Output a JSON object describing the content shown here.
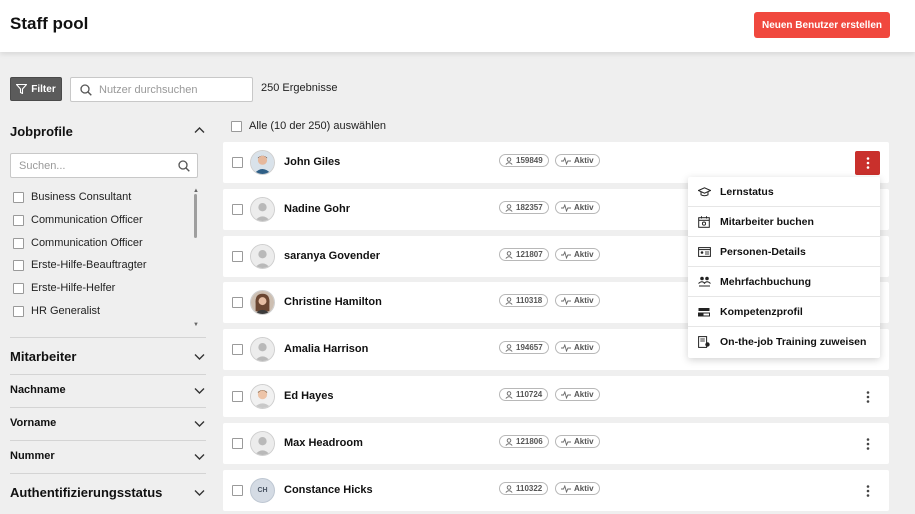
{
  "header": {
    "title": "Staff pool",
    "create_button": "Neuen Benutzer erstellen",
    "accent_color": "#f0483e"
  },
  "toolbar": {
    "filter_label": "Filter",
    "search_placeholder": "Nutzer durchsuchen",
    "result_count": "250 Ergebnisse"
  },
  "sidebar": {
    "jobprofile": {
      "title": "Jobprofile",
      "search_placeholder": "Suchen...",
      "items": [
        "Business Consultant",
        "Communication Officer",
        "Communication Officer",
        "Erste-Hilfe-Beauftragter",
        "Erste-Hilfe-Helfer",
        "HR Generalist"
      ]
    },
    "sections": [
      {
        "title": "Mitarbeiter"
      },
      {
        "title": "Nachname"
      },
      {
        "title": "Vorname"
      },
      {
        "title": "Nummer"
      },
      {
        "title": "Authentifizierungsstatus"
      }
    ]
  },
  "list": {
    "select_all": "Alle (10 der 250) auswählen",
    "rows": [
      {
        "name": "John Giles",
        "id": "159849",
        "status": "Aktiv",
        "avatar": "photo-icon"
      },
      {
        "name": "Nadine Gohr",
        "id": "182357",
        "status": "Aktiv",
        "avatar": "person-placeholder-icon"
      },
      {
        "name": "saranya Govender",
        "id": "121807",
        "status": "Aktiv",
        "avatar": "person-placeholder-icon"
      },
      {
        "name": "Christine Hamilton",
        "id": "110318",
        "status": "Aktiv",
        "avatar": "photo-icon"
      },
      {
        "name": "Amalia Harrison",
        "id": "194657",
        "status": "Aktiv",
        "avatar": "person-placeholder-icon"
      },
      {
        "name": "Ed Hayes",
        "id": "110724",
        "status": "Aktiv",
        "avatar": "photo-icon"
      },
      {
        "name": "Max Headroom",
        "id": "121806",
        "status": "Aktiv",
        "avatar": "person-placeholder-icon"
      },
      {
        "name": "Constance Hicks",
        "id": "110322",
        "status": "Aktiv",
        "avatar": "initials",
        "initials": "CH"
      }
    ]
  },
  "context_menu": {
    "items": [
      {
        "label": "Lernstatus",
        "icon": "graduation-cap-icon"
      },
      {
        "label": "Mitarbeiter buchen",
        "icon": "calendar-book-icon"
      },
      {
        "label": "Personen-Details",
        "icon": "id-card-icon"
      },
      {
        "label": "Mehrfachbuchung",
        "icon": "group-icon"
      },
      {
        "label": "Kompetenzprofil",
        "icon": "competence-icon"
      },
      {
        "label": "On-the-job Training zuweisen",
        "icon": "training-assign-icon"
      }
    ]
  }
}
